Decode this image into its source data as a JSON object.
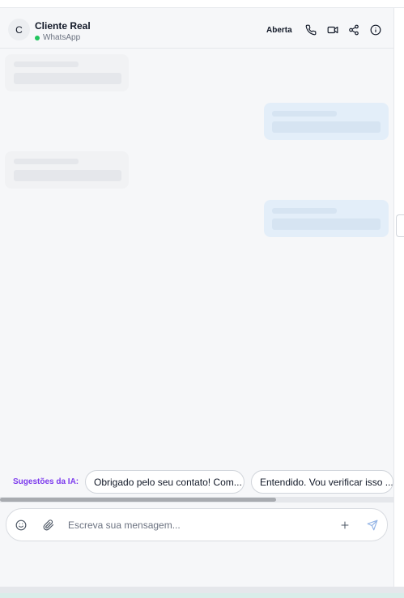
{
  "header": {
    "avatar_initial": "C",
    "contact_name": "Cliente Real",
    "channel": "WhatsApp",
    "status": "Aberta"
  },
  "icons": {
    "call": "phone-icon",
    "video": "video-icon",
    "share": "share-icon",
    "info": "info-icon",
    "emoji": "emoji-icon",
    "attach": "paperclip-icon",
    "add": "plus-icon",
    "send": "send-icon"
  },
  "suggestions": {
    "label": "Sugestões da IA:",
    "items": [
      "Obrigado pelo seu contato! Com...",
      "Entendido. Vou verificar isso ..."
    ]
  },
  "composer": {
    "placeholder": "Escreva sua mensagem..."
  },
  "colors": {
    "accent_ai": "#7c3aed",
    "online": "#22c55e",
    "outgoing_bubble": "#e3eef9",
    "incoming_bubble": "#f1f2f4",
    "send_icon": "#93b4e6"
  }
}
